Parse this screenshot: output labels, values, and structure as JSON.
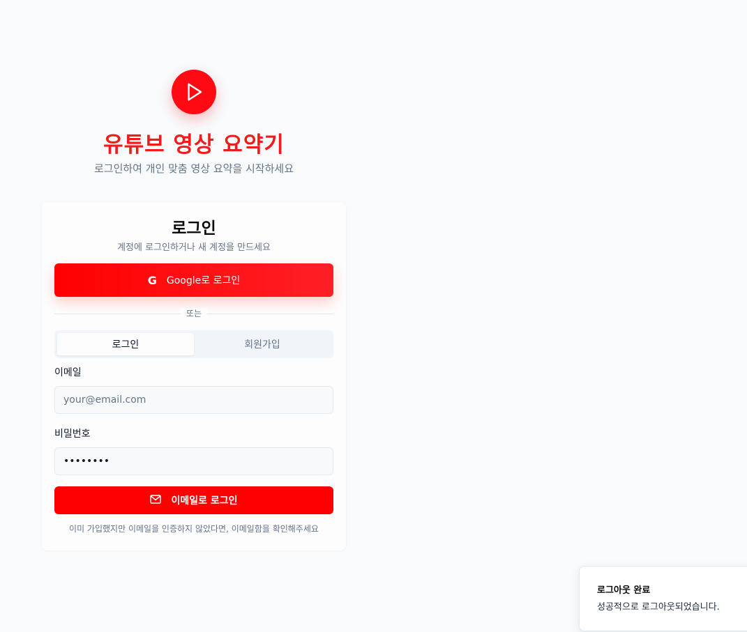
{
  "brand": {
    "icon": "play-icon",
    "title": "유튜브 영상 요약기",
    "subtitle": "로그인하여 개인 맞춤 영상 요약을 시작하세요",
    "color": "#f01c1c"
  },
  "login_card": {
    "title": "로그인",
    "subtitle": "계정에 로그인하거나 새 계정을 만드세요",
    "google_button": {
      "icon": "google-icon",
      "label": "Google로 로그인"
    },
    "divider_text": "또는",
    "tabs": [
      {
        "label": "로그인",
        "active": true
      },
      {
        "label": "회원가입",
        "active": false
      }
    ],
    "email": {
      "label": "이메일",
      "placeholder": "your@email.com",
      "value": ""
    },
    "password": {
      "label": "비밀번호",
      "value": "••••••••"
    },
    "email_button": {
      "icon": "mail-icon",
      "label": "이메일로 로그인"
    },
    "hint": "이미 가입했지만 이메일을 인증하지 않았다면, 이메일함을 확인해주세요"
  },
  "toast": {
    "title": "로그아웃 완료",
    "description": "성공적으로 로그아웃되었습니다."
  },
  "colors": {
    "accent": "#ff0000",
    "background": "#f8fafc",
    "muted_text": "#64748b"
  }
}
